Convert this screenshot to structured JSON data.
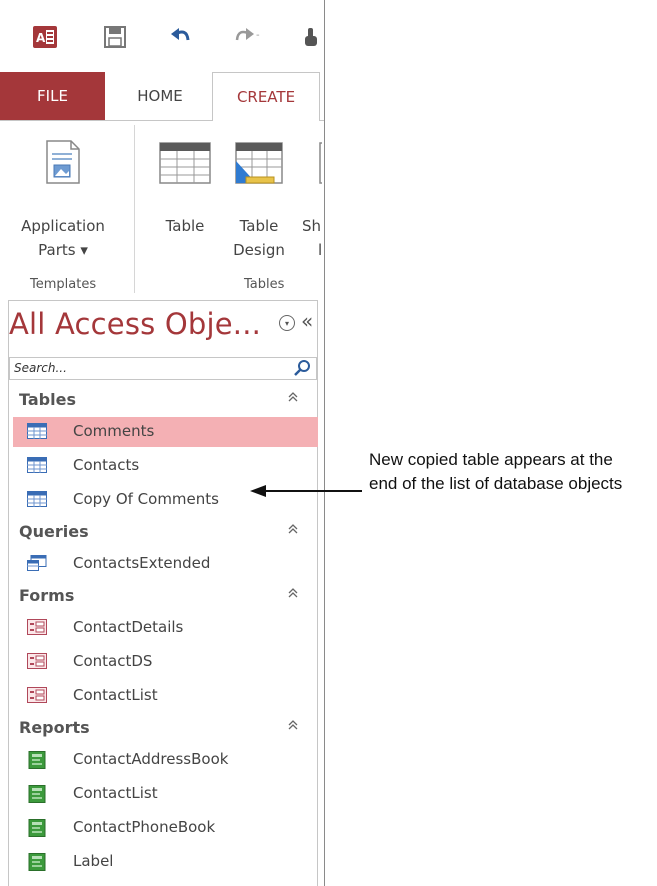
{
  "ribbon_tabs": {
    "file": "FILE",
    "home": "HOME",
    "create": "CREATE"
  },
  "ribbon": {
    "application_parts": [
      "Application",
      "Parts ▾"
    ],
    "table": "Table",
    "table_design": [
      "Table",
      "Design"
    ],
    "shared_partial": [
      "Sh",
      "l"
    ],
    "groups": {
      "templates": "Templates",
      "tables": "Tables"
    }
  },
  "nav_pane": {
    "title": "All Access Obje...",
    "search_placeholder": "Search...",
    "groups": [
      {
        "name": "Tables",
        "items": [
          "Comments",
          "Contacts",
          "Copy Of Comments"
        ],
        "icon": "table-icon"
      },
      {
        "name": "Queries",
        "items": [
          "ContactsExtended"
        ],
        "icon": "query-icon"
      },
      {
        "name": "Forms",
        "items": [
          "ContactDetails",
          "ContactDS",
          "ContactList"
        ],
        "icon": "form-icon"
      },
      {
        "name": "Reports",
        "items": [
          "ContactAddressBook",
          "ContactList",
          "ContactPhoneBook",
          "Label"
        ],
        "icon": "report-icon"
      }
    ],
    "selected_item": "Comments"
  },
  "callout": {
    "line1": "New copied table appears at the",
    "line2": "end of the list of database objects"
  },
  "colors": {
    "accent": "#a4373a",
    "selected_row": "#f4b0b4"
  }
}
